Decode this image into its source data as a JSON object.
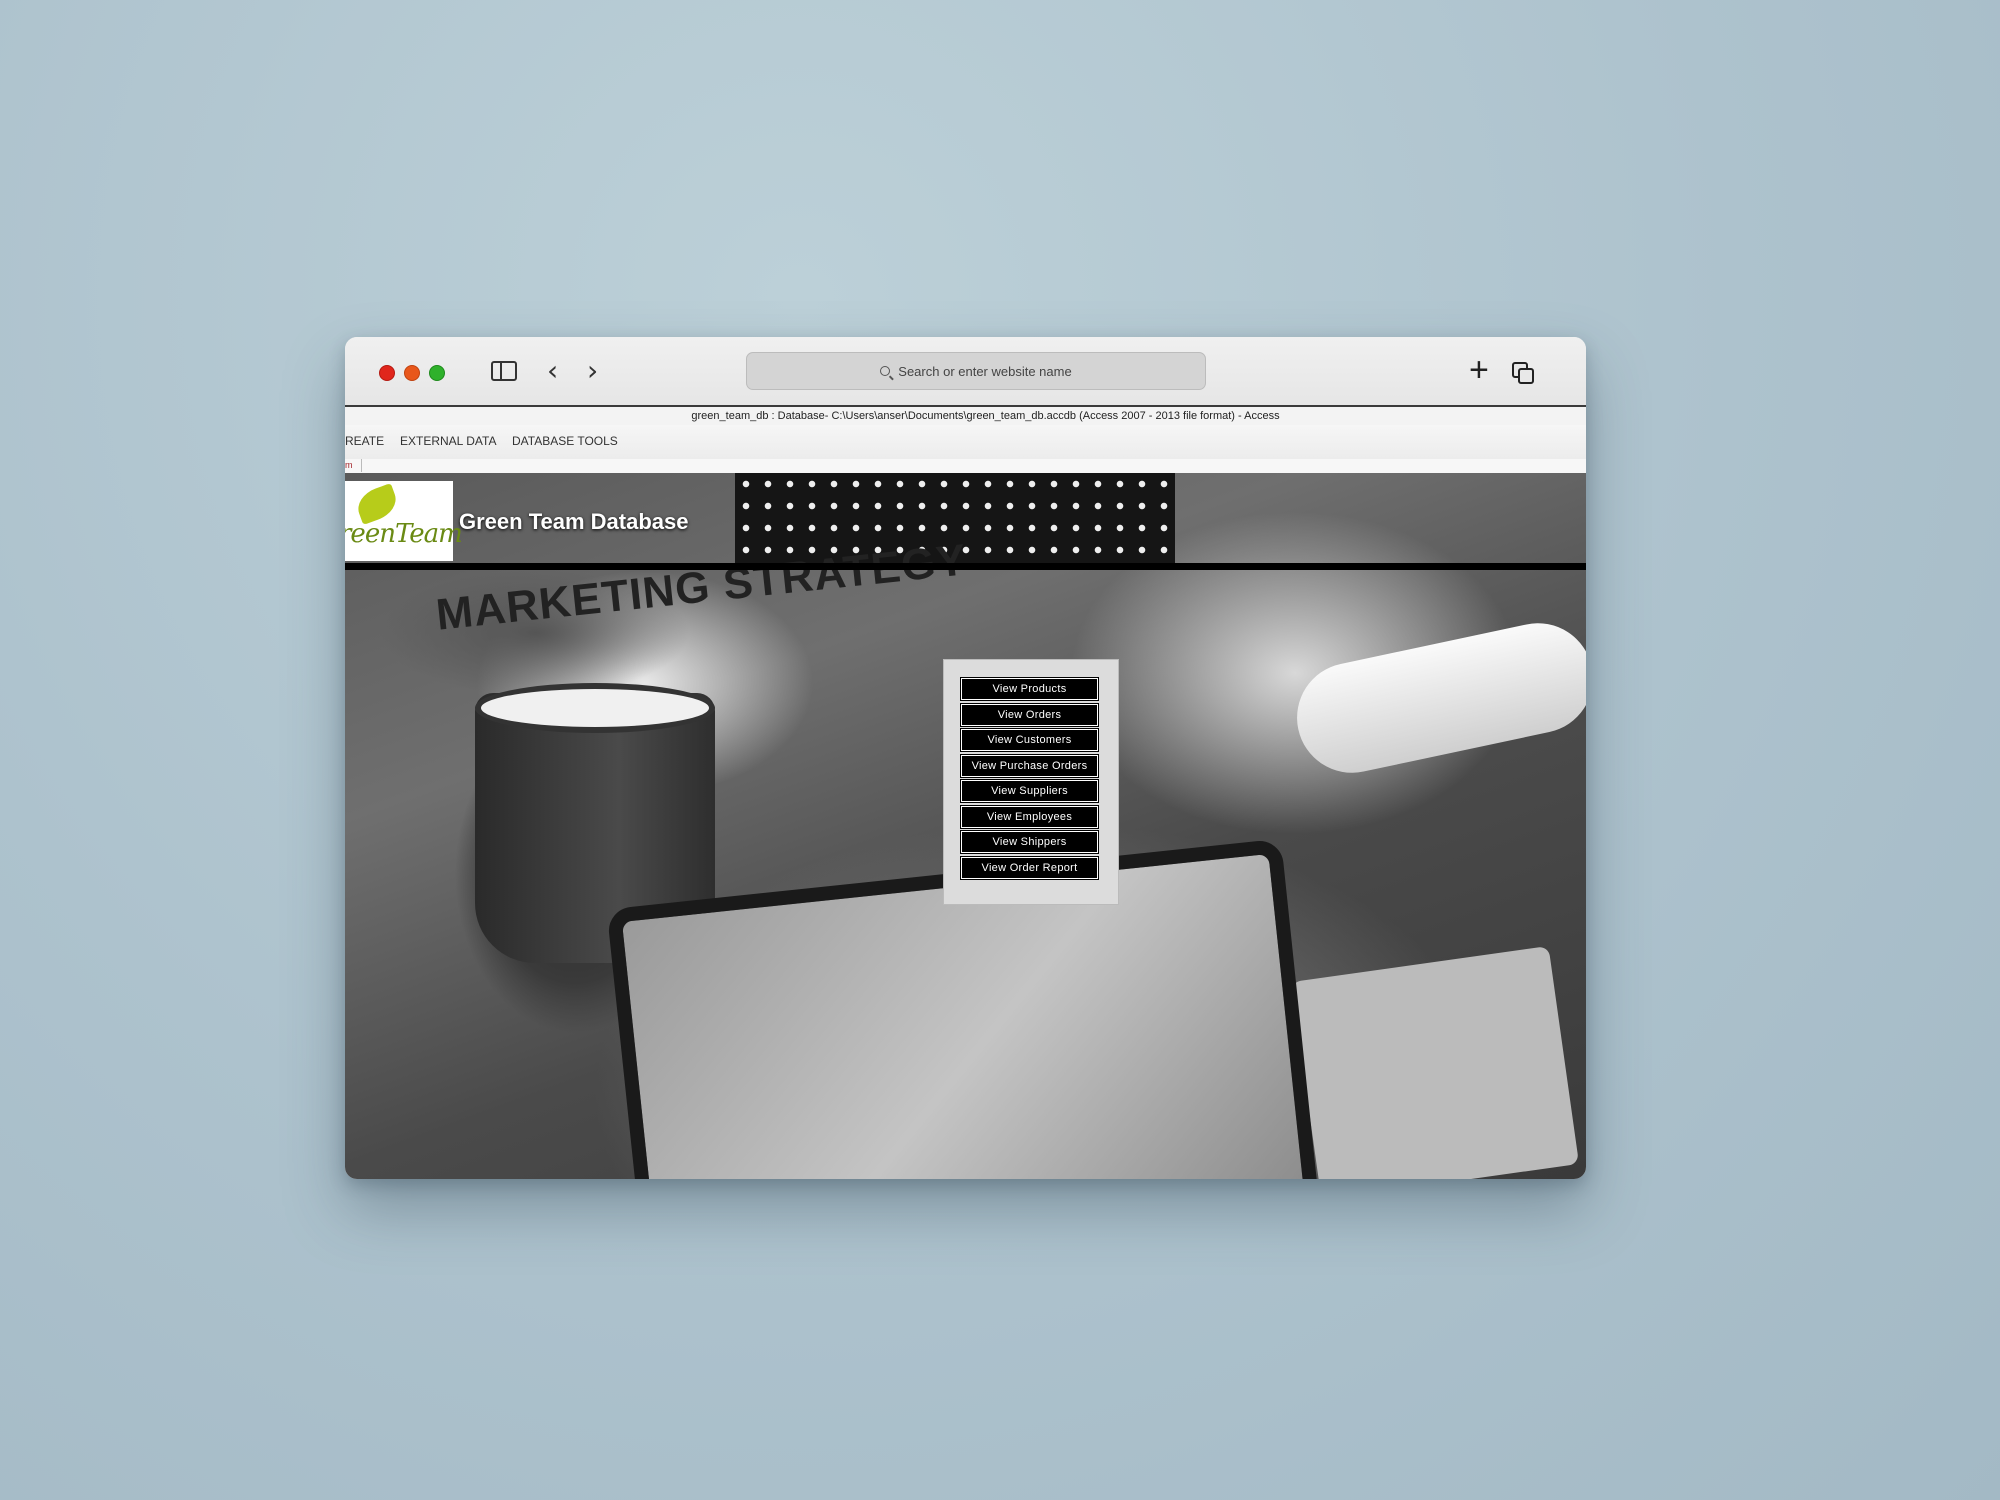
{
  "browser": {
    "address_placeholder": "Search or enter website name"
  },
  "access": {
    "window_title": "green_team_db : Database- C:\\Users\\anser\\Documents\\green_team_db.accdb (Access 2007 - 2013 file format) - Access",
    "ribbon_tabs": [
      "REATE",
      "EXTERNAL DATA",
      "DATABASE TOOLS"
    ],
    "doc_tab": "m"
  },
  "form": {
    "logo_text": "reenTeam",
    "title": "Green Team Database",
    "background_text": "MARKETING STRATEGY",
    "buttons": [
      "View Products",
      "View Orders",
      "View Customers",
      "View Purchase Orders",
      "View Suppliers",
      "View Employees",
      "View Shippers",
      "View Order Report"
    ]
  }
}
